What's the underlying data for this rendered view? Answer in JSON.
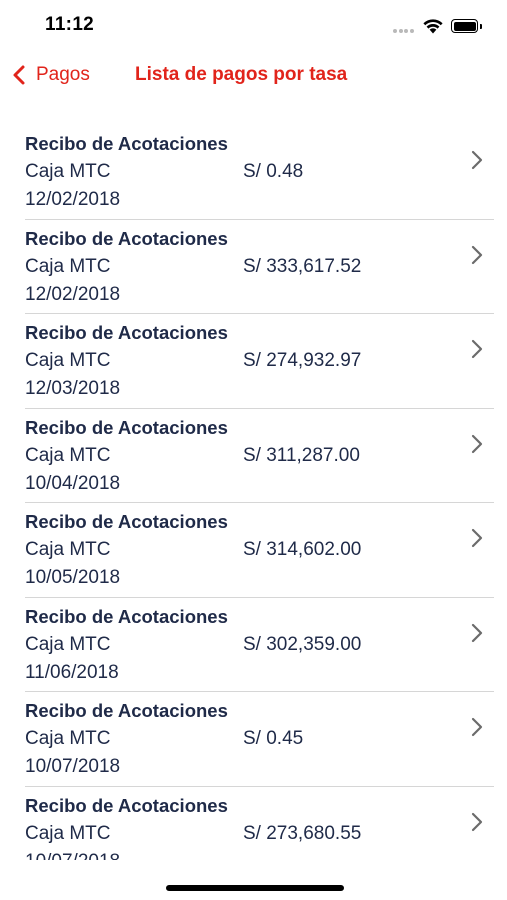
{
  "status_bar": {
    "time": "11:12",
    "icons": [
      "cellular-dots-icon",
      "wifi-icon",
      "battery-icon"
    ]
  },
  "nav": {
    "back_label": "Pagos",
    "title": "Lista de pagos por tasa",
    "accent_color": "#e1241b"
  },
  "payments": [
    {
      "title": "Recibo de Acotaciones",
      "source": "Caja MTC",
      "amount": "S/ 0.48",
      "date": "12/02/2018"
    },
    {
      "title": "Recibo de Acotaciones",
      "source": "Caja MTC",
      "amount": "S/ 333,617.52",
      "date": "12/02/2018"
    },
    {
      "title": "Recibo de Acotaciones",
      "source": "Caja MTC",
      "amount": "S/ 274,932.97",
      "date": "12/03/2018"
    },
    {
      "title": "Recibo de Acotaciones",
      "source": "Caja MTC",
      "amount": "S/ 311,287.00",
      "date": "10/04/2018"
    },
    {
      "title": "Recibo de Acotaciones",
      "source": "Caja MTC",
      "amount": "S/ 314,602.00",
      "date": "10/05/2018"
    },
    {
      "title": "Recibo de Acotaciones",
      "source": "Caja MTC",
      "amount": "S/ 302,359.00",
      "date": "11/06/2018"
    },
    {
      "title": "Recibo de Acotaciones",
      "source": "Caja MTC",
      "amount": "S/ 0.45",
      "date": "10/07/2018"
    },
    {
      "title": "Recibo de Acotaciones",
      "source": "Caja MTC",
      "amount": "S/ 273,680.55",
      "date": "10/07/2018"
    }
  ]
}
